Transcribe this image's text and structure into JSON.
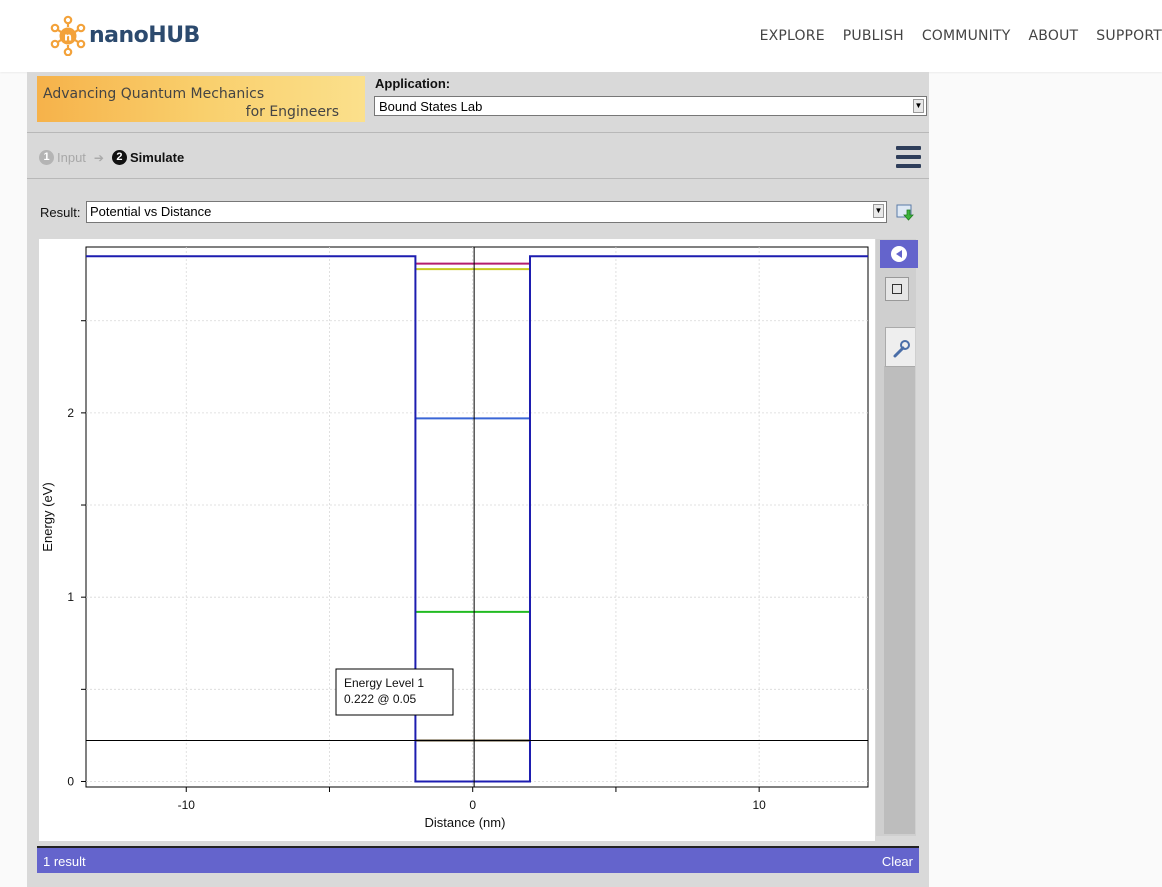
{
  "site": {
    "logo_text": "nanoHUB",
    "nav": [
      "EXPLORE",
      "PUBLISH",
      "COMMUNITY",
      "ABOUT",
      "SUPPORT"
    ]
  },
  "tool": {
    "banner_line1": "Advancing Quantum Mechanics",
    "banner_line2": "for Engineers",
    "application_label": "Application:",
    "application_value": "Bound States Lab",
    "steps": [
      {
        "number": "1",
        "label": "Input",
        "active": false
      },
      {
        "number": "2",
        "label": "Simulate",
        "active": true
      }
    ],
    "result_label": "Result:",
    "result_value": "Potential vs Distance",
    "status_count": "1 result",
    "status_clear": "Clear"
  },
  "chart_data": {
    "type": "line",
    "title": "",
    "xlabel": "Distance (nm)",
    "ylabel": "Energy (eV)",
    "xlim": [
      -13.5,
      13.8
    ],
    "ylim": [
      -0.03,
      2.9
    ],
    "xticks": [
      -10,
      0,
      10
    ],
    "yticks": [
      0,
      1,
      2
    ],
    "grid": true,
    "potential": {
      "color": "#1d1db0",
      "x": [
        -13.5,
        -2.0,
        -2.0,
        -2.0,
        -2.0,
        2.0,
        2.0,
        2.0,
        2.0,
        13.8
      ],
      "y": [
        2.85,
        2.85,
        1.93,
        0.95,
        0.0,
        0.0,
        0.95,
        1.93,
        2.85,
        2.85
      ]
    },
    "energy_levels": [
      {
        "energy": 0.222,
        "x_range": [
          -2.0,
          2.0
        ],
        "color": "#5a4a2a"
      },
      {
        "energy": 0.92,
        "x_range": [
          -2.0,
          2.0
        ],
        "color": "#22bb22"
      },
      {
        "energy": 1.97,
        "x_range": [
          -2.0,
          2.0
        ],
        "color": "#3a66d6"
      },
      {
        "energy": 2.78,
        "x_range": [
          -2.0,
          2.0
        ],
        "color": "#c8c81e"
      },
      {
        "energy": 2.81,
        "x_range": [
          -2.0,
          2.0
        ],
        "color": "#b41e6e"
      }
    ],
    "crosshair": {
      "x": 0.05,
      "y": 0.222
    },
    "tooltip": {
      "line1": "Energy Level  1",
      "line2": "0.222 @ 0.05"
    }
  }
}
